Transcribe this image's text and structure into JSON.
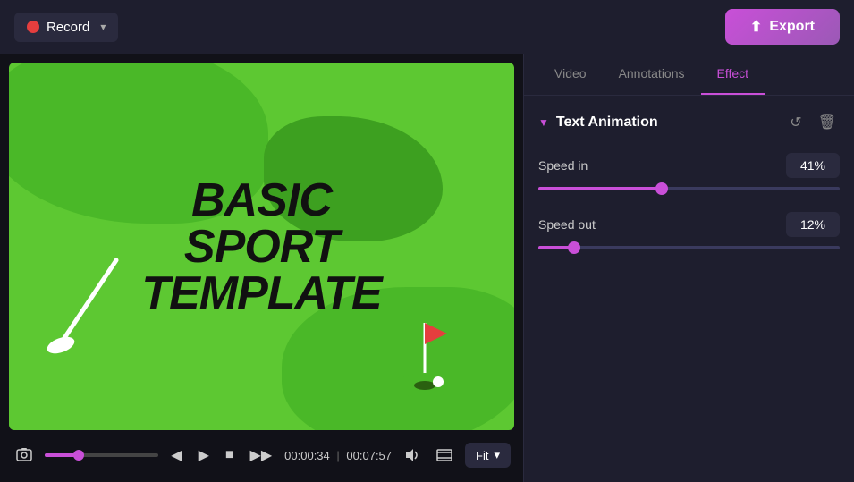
{
  "header": {
    "record_label": "Record",
    "export_label": "Export",
    "export_icon": "⬆"
  },
  "tabs": {
    "items": [
      {
        "id": "video",
        "label": "Video",
        "active": false
      },
      {
        "id": "annotations",
        "label": "Annotations",
        "active": false
      },
      {
        "id": "effect",
        "label": "Effect",
        "active": true
      }
    ]
  },
  "effect_panel": {
    "section_title": "Text Animation",
    "speed_in_label": "Speed in",
    "speed_in_value": "41%",
    "speed_out_label": "Speed out",
    "speed_out_value": "12%"
  },
  "player": {
    "current_time": "00:00:34",
    "total_time": "00:07:57",
    "fit_label": "Fit"
  },
  "video_text": {
    "line1": "BASIC SPORT",
    "line2": "TEMPLATE"
  }
}
